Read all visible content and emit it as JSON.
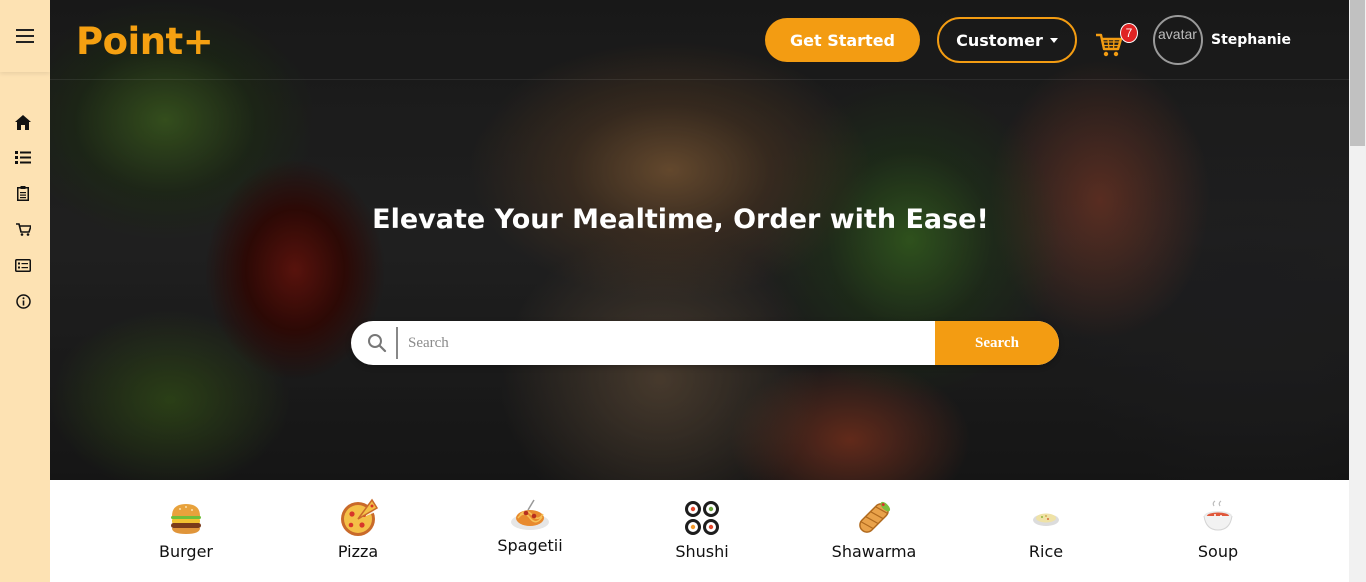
{
  "header": {
    "logo": "Point+",
    "get_started_label": "Get Started",
    "customer_label": "Customer",
    "cart_count": "7",
    "avatar_alt": "avatar",
    "username": "Stephanie"
  },
  "sidebar": {
    "items": [
      {
        "name": "home",
        "icon": "home-icon"
      },
      {
        "name": "list",
        "icon": "list-icon"
      },
      {
        "name": "orders",
        "icon": "clipboard-icon"
      },
      {
        "name": "cart",
        "icon": "cart-icon"
      },
      {
        "name": "details",
        "icon": "id-card-icon"
      },
      {
        "name": "info",
        "icon": "info-icon"
      }
    ]
  },
  "hero": {
    "headline": "Elevate Your Mealtime, Order with Ease!"
  },
  "search": {
    "placeholder": "Search",
    "button_label": "Search"
  },
  "categories": [
    {
      "label": "Burger"
    },
    {
      "label": "Pizza"
    },
    {
      "label": "Spagetii"
    },
    {
      "label": "Shushi"
    },
    {
      "label": "Shawarma"
    },
    {
      "label": "Rice"
    },
    {
      "label": "Soup"
    }
  ],
  "colors": {
    "accent": "#f39c12",
    "sidebar_bg": "#fde2b3",
    "badge": "#e02424"
  }
}
